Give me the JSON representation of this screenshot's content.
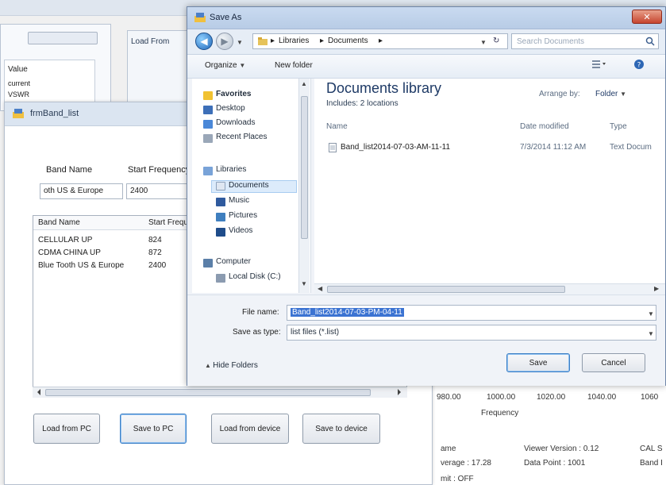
{
  "background": {
    "list_header_value": "Value",
    "list_rows": [
      "current",
      "VSWR"
    ],
    "load_from_window_title": "Load From",
    "axis_ticks": [
      "980.00",
      "1000.00",
      "1020.00",
      "1040.00",
      "1060"
    ],
    "axis_label": "Frequency",
    "info": {
      "name_label": "ame",
      "average": "verage : 17.28",
      "limit": "mit : OFF",
      "viewer_version": "Viewer Version : 0.12",
      "data_point": "Data Point : 1001",
      "cal": "CAL S",
      "band": "Band I"
    }
  },
  "band_window": {
    "title": "frmBand_list",
    "band_name_label": "Band Name",
    "start_freq_label": "Start Frequency",
    "band_name_value": "oth US & Europe",
    "start_freq_value": "2400",
    "grid": {
      "headers": [
        "Band Name",
        "Start Freque"
      ],
      "rows": [
        [
          "CELLULAR UP",
          "824"
        ],
        [
          "CDMA CHINA UP",
          "872"
        ],
        [
          "Blue Tooth US & Europe",
          "2400"
        ]
      ]
    },
    "buttons": {
      "load_pc": "Load from PC",
      "save_pc": "Save to PC",
      "load_device": "Load from device",
      "save_device": "Save to device"
    }
  },
  "save_dialog": {
    "title": "Save As",
    "breadcrumb": [
      "Libraries",
      "Documents"
    ],
    "search_placeholder": "Search Documents",
    "organize": "Organize",
    "new_folder": "New folder",
    "favorites_header": "Favorites",
    "nav_items": {
      "desktop": "Desktop",
      "downloads": "Downloads",
      "recent": "Recent Places",
      "libraries": "Libraries",
      "documents": "Documents",
      "music": "Music",
      "pictures": "Pictures",
      "videos": "Videos",
      "computer": "Computer",
      "localdisk": "Local Disk (C:)"
    },
    "library_title": "Documents library",
    "includes": "Includes: 2 locations",
    "arrange_label": "Arrange by:",
    "arrange_value": "Folder",
    "columns": {
      "name": "Name",
      "date": "Date modified",
      "type": "Type"
    },
    "file": {
      "name": "Band_list2014-07-03-AM-11-11",
      "date": "7/3/2014 11:12 AM",
      "type": "Text Docum"
    },
    "file_name_label": "File name:",
    "file_name_value": "Band_list2014-07-03-PM-04-11",
    "save_type_label": "Save as type:",
    "save_type_value": "list files (*.list)",
    "hide_folders": "Hide Folders",
    "save_button": "Save",
    "cancel_button": "Cancel"
  }
}
